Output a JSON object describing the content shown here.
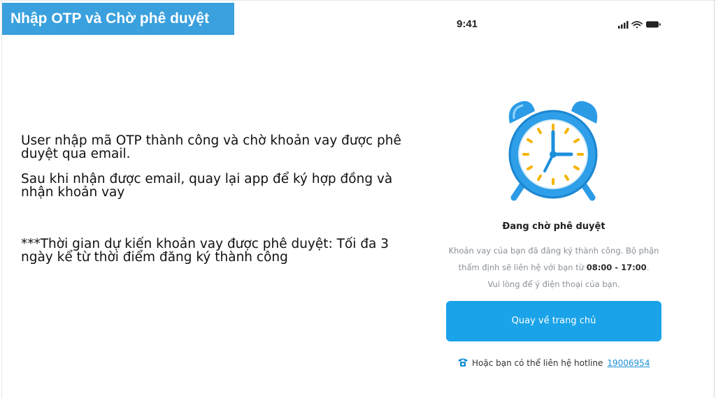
{
  "slide": {
    "title": "Nhập OTP và Chờ phê duyệt",
    "description": {
      "line1": "User nhập mã OTP thành công và chờ khoản vay được phê duyệt qua email.",
      "line2": "Sau khi nhận được email, quay lại app để ký hợp đồng và nhận khoản vay",
      "line3": "***Thời gian dự kiến khoản vay được phê duyệt: Tối đa 3 ngày kể từ thời điểm đăng ký thành công"
    }
  },
  "phone": {
    "status_bar": {
      "time": "9:41",
      "icons": [
        "signal-icon",
        "wifi-icon",
        "battery-icon"
      ]
    },
    "illustration": "alarm-clock-icon",
    "approval": {
      "title": "Đang chờ phê duyệt",
      "body_part1": "Khoản vay của bạn đã đăng ký thành công. Bộ phận thẩm định sẽ liên hệ với bạn từ ",
      "hours": "08:00 - 17:00",
      "body_part2": ".",
      "body_part3": "Vui lòng để ý điện thoại của bạn."
    },
    "home_button_label": "Quay về trang chủ",
    "hotline": {
      "icon": "phone-icon",
      "label": "Hoặc bạn có thể liên hệ hotline",
      "number": "19006954"
    },
    "colors": {
      "primary": "#1aa3e8",
      "banner": "#3aa0de",
      "link": "#1a8fd6"
    }
  }
}
